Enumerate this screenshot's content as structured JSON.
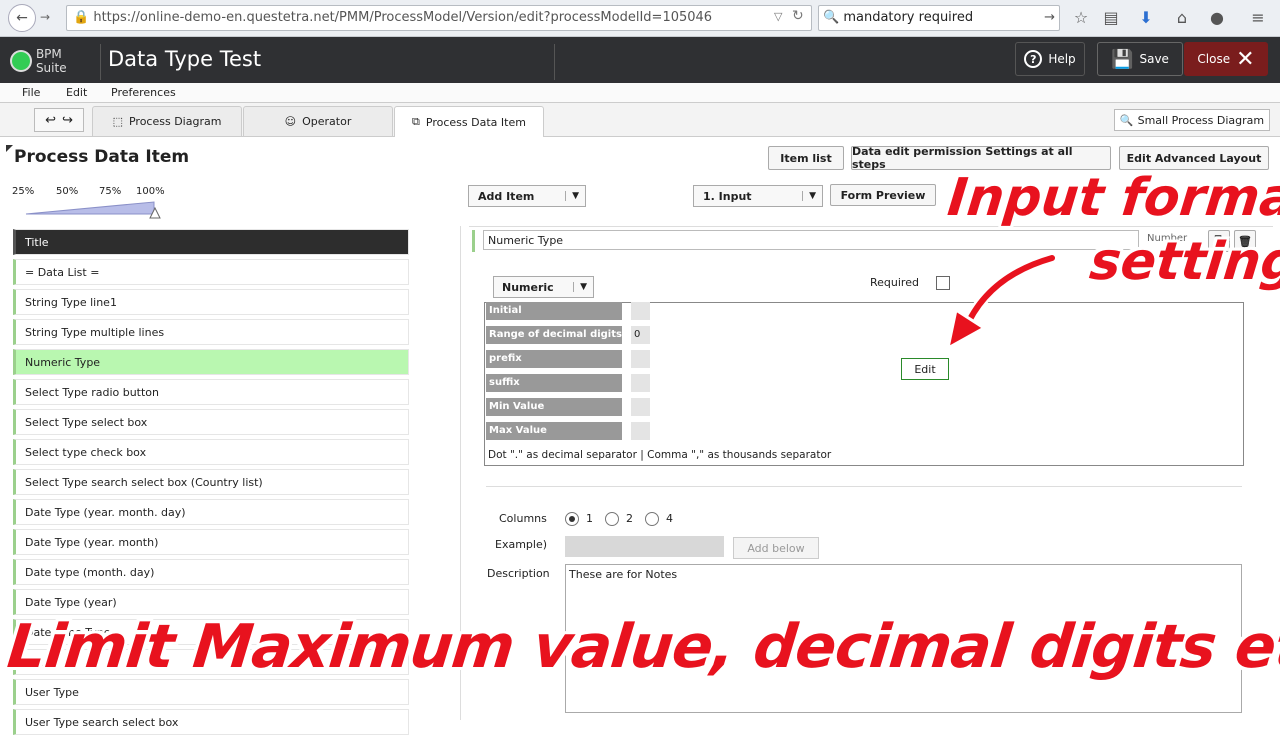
{
  "browser": {
    "url": "https://online-demo-en.questetra.net/PMM/ProcessModel/Version/edit?processModelId=105046",
    "search": "mandatory required"
  },
  "app": {
    "logo_text": "BPM Suite",
    "title": "Data Type Test",
    "help_label": "Help",
    "save_label": "Save",
    "close_label": "Close"
  },
  "menu": [
    "File",
    "Edit",
    "Preferences"
  ],
  "tabs": {
    "process_diagram": "Process Diagram",
    "operator": "Operator",
    "process_data_item": "Process Data Item",
    "small_diagram": "Small Process Diagram"
  },
  "section": {
    "title": "Process Data Item",
    "item_list": "Item list",
    "permission": "Data edit permission Settings at all steps",
    "advanced_layout": "Edit Advanced Layout"
  },
  "zoom": [
    "25%",
    "50%",
    "75%",
    "100%"
  ],
  "controls": {
    "add_item": "Add Item",
    "step_select": "1. Input",
    "form_preview": "Form Preview"
  },
  "items": [
    "Title",
    "= Data List =",
    "String Type line1",
    "String Type multiple lines",
    "Numeric Type",
    "Select Type radio button",
    "Select Type select box",
    "Select type check box",
    "Select Type search select box (Country list)",
    "Date Type (year. month. day)",
    "Date Type (year. month)",
    "Date type (month. day)",
    "Date Type (year)",
    "Date Time Type",
    "File",
    "User Type",
    "User Type search select box"
  ],
  "editor": {
    "name_value": "Numeric Type",
    "number_label": "Number",
    "type_select": "Numeric",
    "required_label": "Required",
    "rows": [
      {
        "label": "Initial",
        "value": ""
      },
      {
        "label": "Range of decimal digits",
        "value": "0"
      },
      {
        "label": "prefix",
        "value": ""
      },
      {
        "label": "suffix",
        "value": ""
      },
      {
        "label": "Min Value",
        "value": ""
      },
      {
        "label": "Max Value",
        "value": ""
      }
    ],
    "edit_button": "Edit",
    "separator_note": "Dot \".\" as decimal separator | Comma \",\" as thousands separator",
    "columns_label": "Columns",
    "column_options": [
      "1",
      "2",
      "4"
    ],
    "example_label": "Example)",
    "add_below": "Add below",
    "description_label": "Description",
    "description_value": "These are for Notes"
  },
  "overlay": {
    "line1": "Input format",
    "line2": "setting",
    "bottom": "Limit Maximum value, decimal digits etc."
  },
  "colors": {
    "accent_green": "#9bd08c",
    "highlight_green": "#b9f7b0",
    "overlay_red": "#e8121e",
    "close_red": "#7a1d1d"
  }
}
